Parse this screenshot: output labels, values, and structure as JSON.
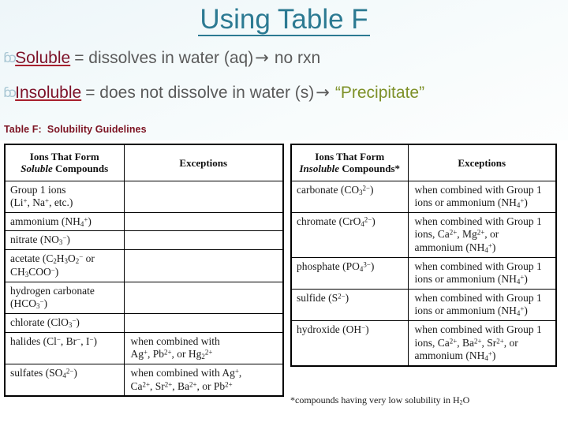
{
  "slide": {
    "title": "Using Table F",
    "bullet_glyph": "ɓɔ",
    "bullets": [
      {
        "term": "Soluble",
        "rest_before_arrow": "= dissolves in water (aq)",
        "arrow": "→",
        "rest_after_arrow": "no rxn",
        "highlight": null
      },
      {
        "term": "Insoluble",
        "rest_before_arrow": "= does not dissolve in water (s)",
        "arrow": "→",
        "rest_after_arrow": "",
        "highlight": "“Precipitate”"
      }
    ],
    "caption": "Table F:  Solubility Guidelines",
    "colors": {
      "title": "#2c7a92",
      "term": "#7d1128",
      "body_text": "#5a5a5a",
      "precipitate": "#7d9027",
      "caption": "#7c1322",
      "bullet_glyph": "#a9c7d4"
    }
  },
  "table_soluble": {
    "headers": {
      "col1_line1": "Ions That Form",
      "col1_line2_italic": "Soluble",
      "col1_line2_rest": " Compounds",
      "col2": "Exceptions"
    },
    "rows": [
      {
        "ion_html": "Group 1 ions<br>(Li<sup>+</sup>, Na<sup>+</sup>, etc.)",
        "exception_html": ""
      },
      {
        "ion_html": "ammonium (NH<sub>4</sub><sup>+</sup>)",
        "exception_html": ""
      },
      {
        "ion_html": "nitrate (NO<sub>3</sub><sup>−</sup>)",
        "exception_html": ""
      },
      {
        "ion_html": "acetate (C<sub>2</sub>H<sub>3</sub>O<sub>2</sub><sup>−</sup> or<br>CH<sub>3</sub>COO<sup>−</sup>)",
        "exception_html": ""
      },
      {
        "ion_html": "hydrogen carbonate<br>(HCO<sub>3</sub><sup>−</sup>)",
        "exception_html": ""
      },
      {
        "ion_html": "chlorate (ClO<sub>3</sub><sup>−</sup>)",
        "exception_html": ""
      },
      {
        "ion_html": "halides (Cl<sup>−</sup>, Br<sup>−</sup>, I<sup>−</sup>)",
        "exception_html": "when combined with<br>Ag<sup>+</sup>, Pb<sup>2+</sup>, or Hg<sub>2</sub><sup>2+</sup>"
      },
      {
        "ion_html": "sulfates (SO<sub>4</sub><sup>2−</sup>)",
        "exception_html": "when combined with Ag<sup>+</sup>,<br>Ca<sup>2+</sup>, Sr<sup>2+</sup>, Ba<sup>2+</sup>, or Pb<sup>2+</sup>"
      }
    ]
  },
  "table_insoluble": {
    "headers": {
      "col1_line1": "Ions That Form",
      "col1_line2_italic": "Insoluble",
      "col1_line2_rest": " Compounds*",
      "col2": "Exceptions"
    },
    "rows": [
      {
        "ion_html": "carbonate (CO<sub>3</sub><sup>2−</sup>)",
        "exception_html": "when combined with Group 1<br>ions or ammonium (NH<sub>4</sub><sup>+</sup>)"
      },
      {
        "ion_html": "chromate (CrO<sub>4</sub><sup>2−</sup>)",
        "exception_html": "when combined with Group 1<br>ions, Ca<sup>2+</sup>, Mg<sup>2+</sup>, or<br>ammonium (NH<sub>4</sub><sup>+</sup>)"
      },
      {
        "ion_html": "phosphate (PO<sub>4</sub><sup>3−</sup>)",
        "exception_html": "when combined with Group 1<br>ions or ammonium (NH<sub>4</sub><sup>+</sup>)"
      },
      {
        "ion_html": "sulfide (S<sup>2−</sup>)",
        "exception_html": "when combined with Group 1<br>ions or ammonium (NH<sub>4</sub><sup>+</sup>)"
      },
      {
        "ion_html": "hydroxide (OH<sup>−</sup>)",
        "exception_html": "when combined with Group 1<br>ions, Ca<sup>2+</sup>, Ba<sup>2+</sup>, Sr<sup>2+</sup>, or<br>ammonium (NH<sub>4</sub><sup>+</sup>)"
      }
    ],
    "footnote_html": "*compounds having very low solubility in H<sub>2</sub>O"
  }
}
